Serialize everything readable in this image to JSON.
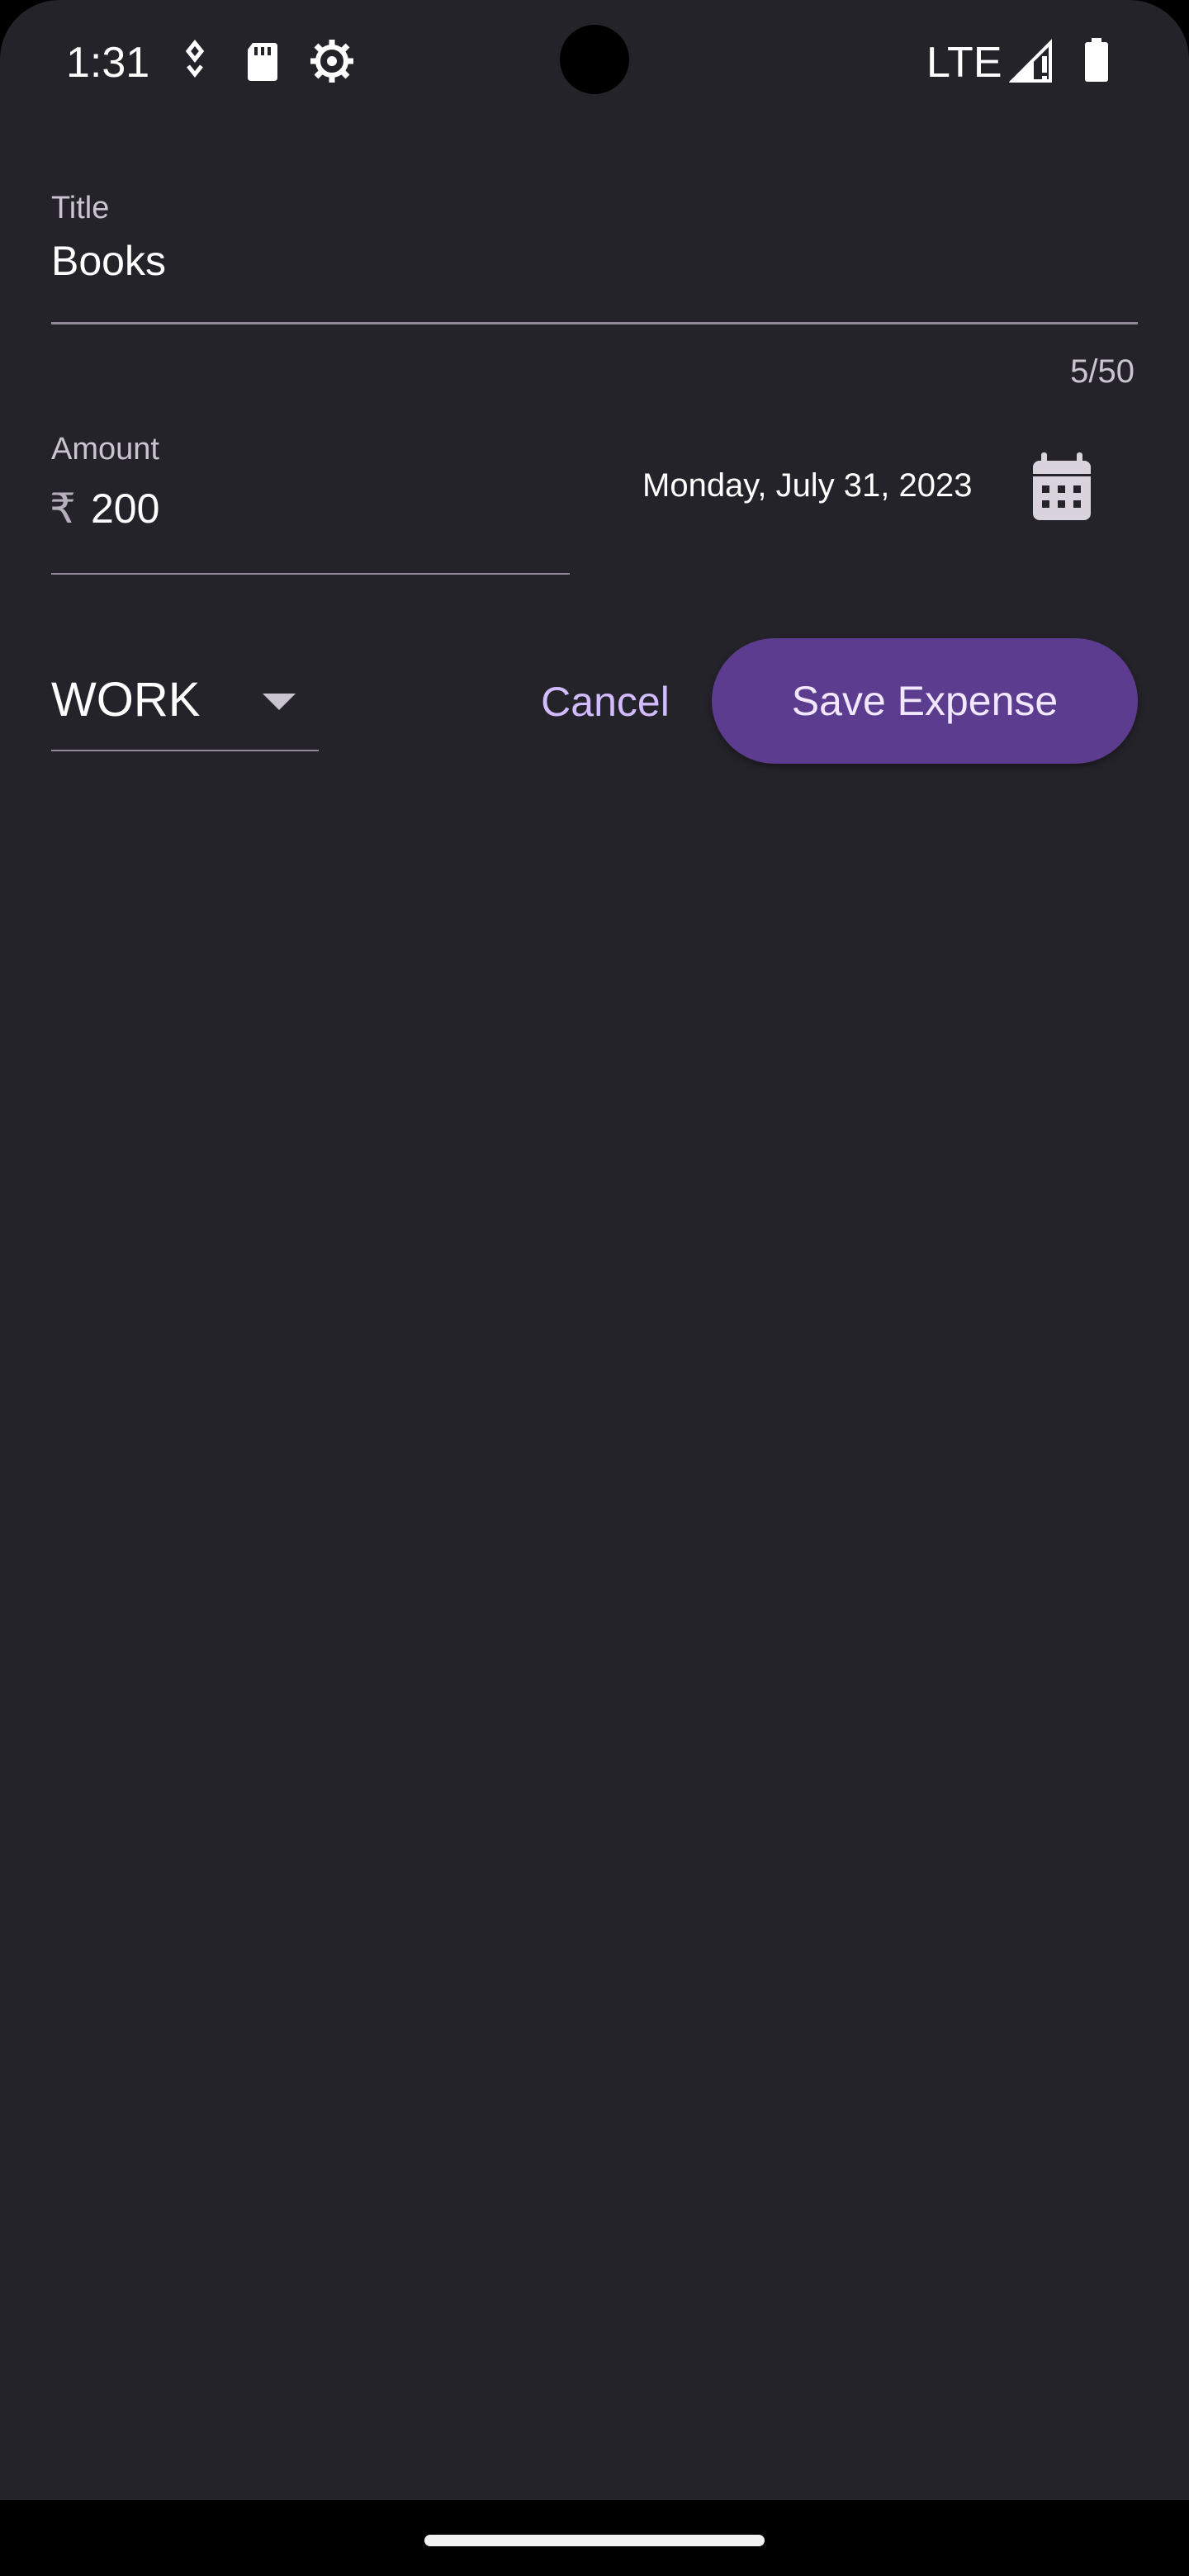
{
  "status_bar": {
    "time": "1:31",
    "network": "LTE",
    "icons": [
      "notification-icon",
      "sd-card-icon",
      "settings-gear-icon",
      "signal-icon",
      "battery-icon"
    ]
  },
  "form": {
    "title": {
      "label": "Title",
      "value": "Books",
      "counter": "5/50"
    },
    "amount": {
      "label": "Amount",
      "prefix": "₹",
      "value": "200"
    },
    "date": {
      "value": "Monday, July 31, 2023",
      "icon": "calendar-icon"
    },
    "category": {
      "selected": "WORK"
    },
    "actions": {
      "cancel_label": "Cancel",
      "save_label": "Save Expense"
    }
  },
  "colors": {
    "background": "#25232a",
    "accent": "#d3bbff",
    "primary_button": "#5c3c8f"
  }
}
